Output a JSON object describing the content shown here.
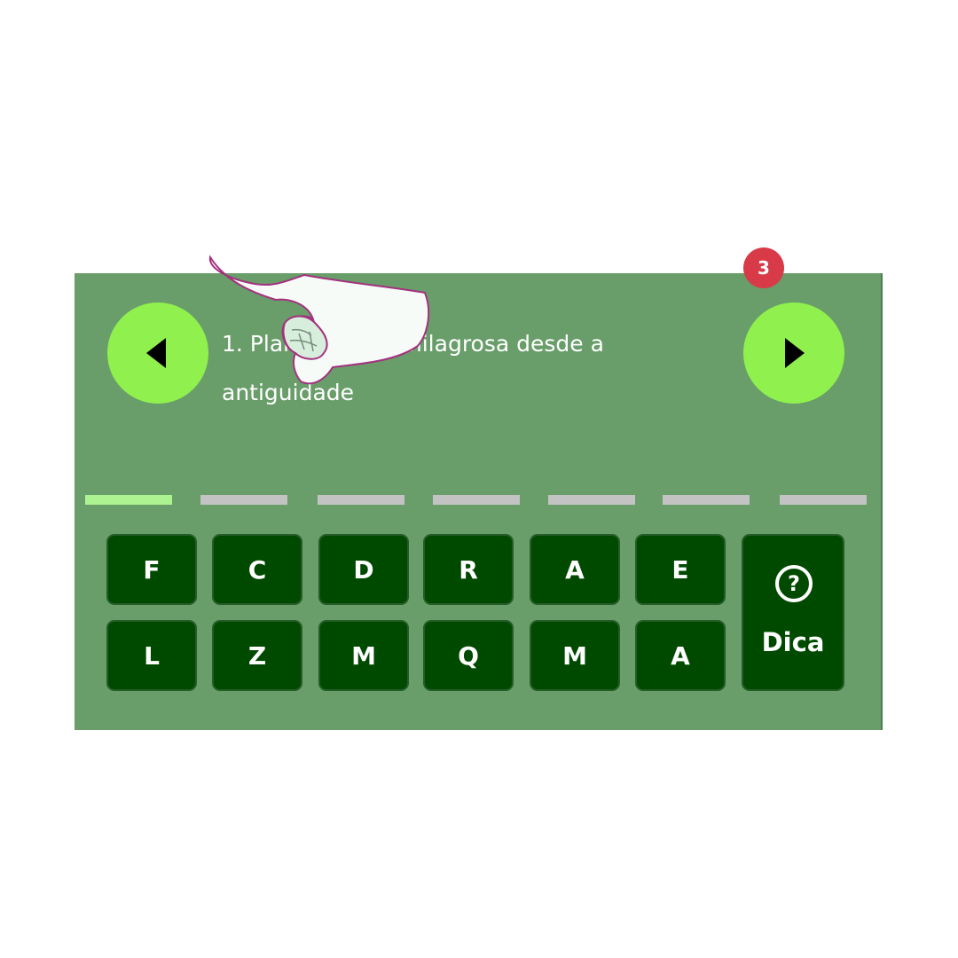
{
  "clue": {
    "text": "1. Planta usada milagrosa desde a antiguidade"
  },
  "navigation": {
    "prev_icon": "triangle-left-icon",
    "next_icon": "triangle-right-icon"
  },
  "answer": {
    "slot_count": 7,
    "active_slot": 1
  },
  "keyboard": {
    "row1": [
      "F",
      "C",
      "D",
      "R",
      "A",
      "E"
    ],
    "row2": [
      "L",
      "Z",
      "M",
      "Q",
      "M",
      "A"
    ]
  },
  "hint": {
    "label": "Dica",
    "icon": "question-circle-icon",
    "icon_glyph": "?",
    "remaining": "3"
  },
  "overlay": {
    "icon": "tap-hand-icon"
  },
  "colors": {
    "panel": "#699e6a",
    "nav_button": "#8ff04e",
    "key": "#004a00",
    "slot_active": "#aef391",
    "slot_inactive": "#c3c3c3",
    "badge": "#d83a48"
  }
}
